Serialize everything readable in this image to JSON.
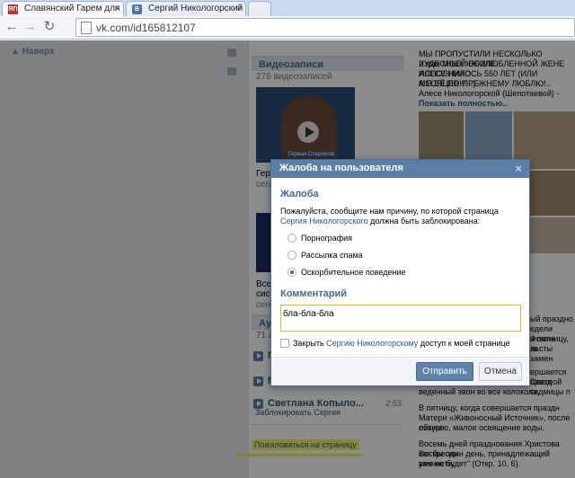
{
  "browser": {
    "tabs": [
      {
        "label": "Славянский Гарем для В",
        "icon": "yandex-icon"
      },
      {
        "label": "Сергий Никологорский",
        "icon": "vk-icon"
      }
    ],
    "url": "vk.com/id165812107"
  },
  "sidebar": {
    "up_label": "Наверх"
  },
  "videos": {
    "header": "Видеозаписи",
    "count": "276 видеозаписей",
    "caption_1": "Герн",
    "caption_1b": "сего",
    "caption_2": "Всел",
    "caption_2b": "сист",
    "caption_2c": "сего",
    "badge": "Герман Стерлигов"
  },
  "audio": {
    "header": "Ауд",
    "count": "71 ау",
    "tracks": [
      {
        "title": "N",
        "duration": ""
      },
      {
        "title": "M",
        "duration": ""
      },
      {
        "title": "Светлана Копыло...",
        "duration": "2:53"
      }
    ]
  },
  "profile_links": {
    "block": "Заблокировать Сергия",
    "complain": "Пожаловаться на страницу"
  },
  "right_column": {
    "lines": [
      "МЫ ПРОПУСТИЛИ НЕСКОЛЬКО ЧУДЕСНЫХ ЮБИЛЕ",
      "2 мая МОЕЙ ВОЗЛЮБЛЕННОЙ ЖЕНЕ АЛЕСЕ НИКО",
      "ИСПОЛНИЛОСЬ 550 ЛЕТ (ИЛИ МЕСЯЦЕВ!!!...) -",
      "А Я ЕЁ ПО-ПРЕЖНЕМУ ЛЮБЛЮ!.."
    ],
    "author": "Алесе Никологорской (Шепотаевой) -",
    "show_full": "Показать полностью..",
    "post_lines": [
      "ый праздно",
      "едели Фомин",
      "и пятницу, зе",
      "льсты замен",
      "ершается празд",
      "Светлой седмицы п",
      "веденный звон во все колокола.",
      "В пятницу, когда совершается праздн",
      "Матери «Живоносный Источник», после литург",
      "обычаю, малое освящение воды.",
      "Восемь дней празднования Христова Воскресен",
      "как бы один день, принадлежащий вечности,",
      "уже не будет\" (Откр. 10, 6)."
    ]
  },
  "dialog": {
    "title": "Жалоба на пользователя",
    "section_title": "Жалоба",
    "description_pre": "Пожалуйста, сообщите нам причину, по которой страница ",
    "description_link": "Сергия Никологорского",
    "description_post": " должна быть заблокирована:",
    "reasons": [
      {
        "label": "Порнография",
        "selected": false
      },
      {
        "label": "Рассылка спама",
        "selected": false
      },
      {
        "label": "Оскорбительное поведение",
        "selected": true
      }
    ],
    "comment_title": "Комментарий",
    "comment_value": "бла-бла-бла",
    "close_access_pre": "Закрыть ",
    "close_access_link": "Сергию Никологорскому",
    "close_access_post": " доступ к моей странице",
    "send_label": "Отправить",
    "cancel_label": "Отмена",
    "close_glyph": "×"
  },
  "colors": {
    "accent": "#5b7fa6",
    "link": "#2b587a",
    "highlight": "#f3ee35"
  }
}
